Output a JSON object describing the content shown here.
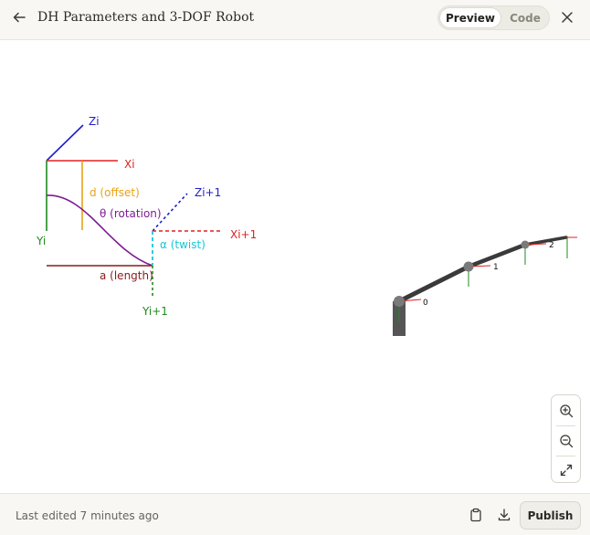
{
  "header": {
    "title": "DH Parameters and 3-DOF Robot",
    "back_icon": "arrow-left-icon",
    "tabs": {
      "preview": "Preview",
      "code": "Code"
    },
    "active_tab": "Preview",
    "close_icon": "close-icon"
  },
  "diagram": {
    "labels": {
      "zi": "Zi",
      "xi": "Xi",
      "yi": "Yi",
      "zi1": "Zi+1",
      "xi1": "Xi+1",
      "yi1": "Yi+1",
      "offset": "d (offset)",
      "rotation": "θ (rotation)",
      "twist": "α (twist)",
      "length": "a (length)"
    },
    "colors": {
      "z_axis": "#1f1fc8",
      "x_axis": "#e02020",
      "y_axis": "#1f8a1f",
      "offset": "#e8a317",
      "rotation": "#7d1d93",
      "twist": "#18c8d8",
      "length": "#8b1a1a"
    }
  },
  "robot": {
    "joint_labels": [
      "0",
      "1",
      "2"
    ],
    "colors": {
      "link": "#3a3a3a",
      "base": "#555555",
      "joint": "#7a7a7a"
    }
  },
  "zoom": {
    "zoom_in_icon": "zoom-in-icon",
    "zoom_out_icon": "zoom-out-icon",
    "fit_icon": "expand-icon"
  },
  "footer": {
    "status": "Last edited 7 minutes ago",
    "copy_icon": "clipboard-icon",
    "download_icon": "download-icon",
    "publish_label": "Publish"
  }
}
